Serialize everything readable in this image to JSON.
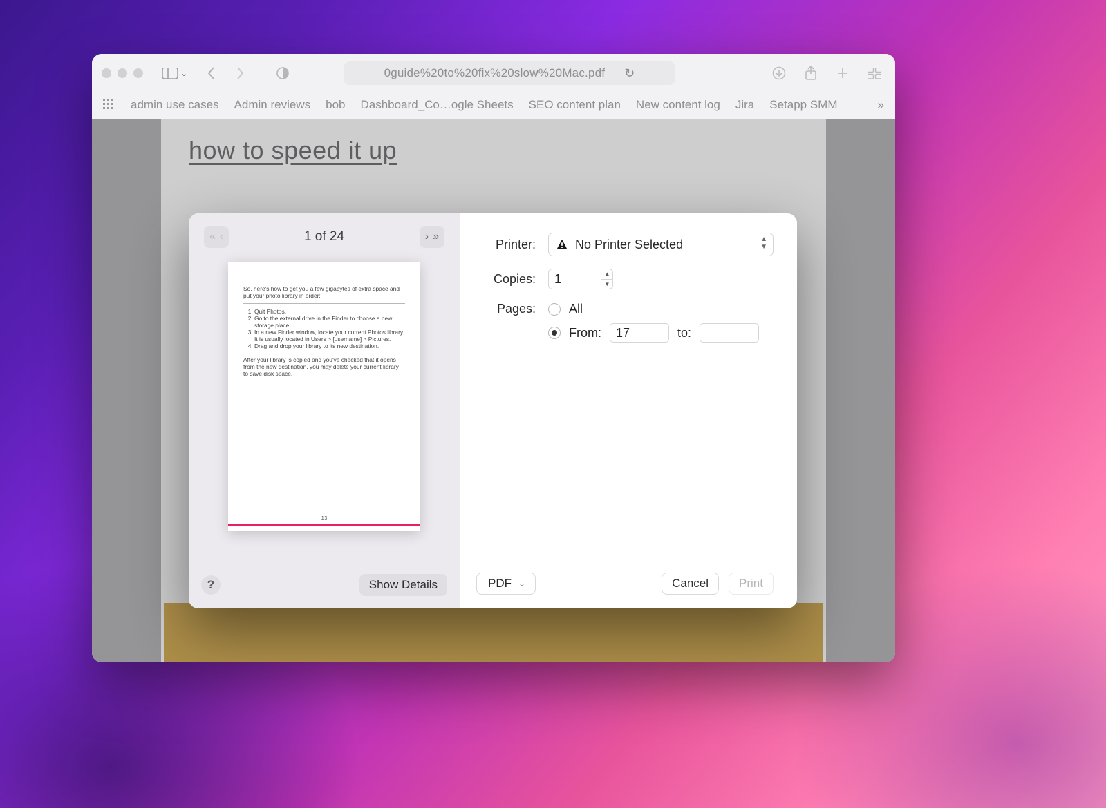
{
  "browser": {
    "url_display": "0guide%20to%20fix%20slow%20Mac.pdf",
    "bookmarks": [
      "admin use cases",
      "Admin reviews",
      "bob",
      "Dashboard_Co…ogle Sheets",
      "SEO content plan",
      "New content log",
      "Jira",
      "Setapp SMM"
    ]
  },
  "document": {
    "visible_heading": "how to speed it up"
  },
  "preview_page": {
    "intro": "So, here's how to get you a few gigabytes of extra space and put your photo library in order:",
    "steps": [
      "Quit Photos.",
      "Go to the external drive in the Finder to choose a new storage place.",
      "In a new Finder window, locate your current Photos library. It is usually located in Users > [username] > Pictures.",
      "Drag and drop your library to its new destination."
    ],
    "after": "After your library is copied and you've checked that it opens from the new destination, you may delete your current library to save disk space.",
    "page_number": "13"
  },
  "print": {
    "page_indicator": "1 of 24",
    "show_details": "Show Details",
    "labels": {
      "printer": "Printer:",
      "copies": "Copies:",
      "pages": "Pages:",
      "all": "All",
      "from": "From:",
      "to": "to:"
    },
    "printer_selected": "No Printer Selected",
    "copies": "1",
    "pages_mode": "from",
    "from_value": "17",
    "to_value": "",
    "pdf_label": "PDF",
    "cancel": "Cancel",
    "print_label": "Print"
  }
}
